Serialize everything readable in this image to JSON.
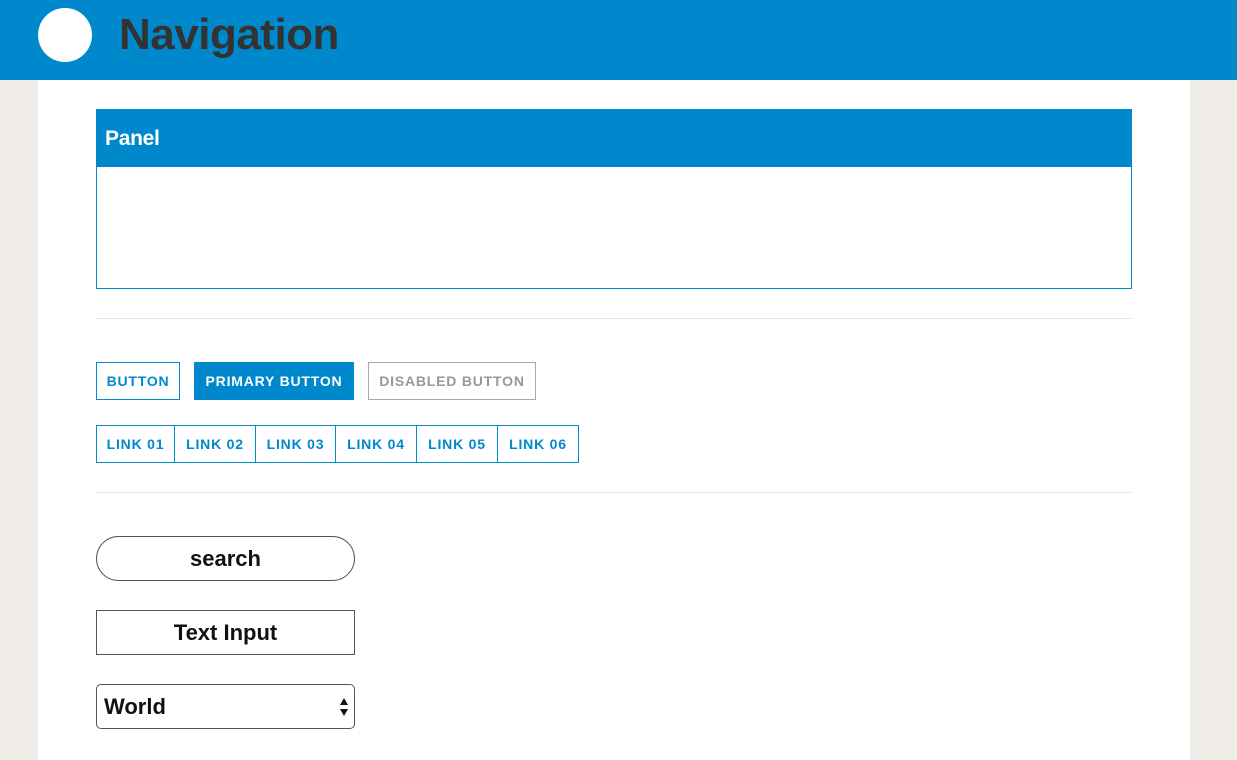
{
  "header": {
    "title": "Navigation",
    "logo_icon": "circle-logo-icon",
    "background_color": "#0088cc"
  },
  "panel": {
    "title": "Panel"
  },
  "buttons": {
    "button_label": "BUTTON",
    "primary_label": "PRIMARY BUTTON",
    "disabled_label": "DISABLED BUTTON"
  },
  "links": [
    {
      "label": "LINK 01"
    },
    {
      "label": "LINK 02"
    },
    {
      "label": "LINK 03"
    },
    {
      "label": "LINK 04"
    },
    {
      "label": "LINK 05"
    },
    {
      "label": "LINK 06"
    }
  ],
  "form": {
    "search_placeholder": "search",
    "text_input_placeholder": "Text Input",
    "select_value": "World"
  },
  "colors": {
    "accent": "#0088cc",
    "page_background": "#f0ece8",
    "disabled": "#999999"
  }
}
